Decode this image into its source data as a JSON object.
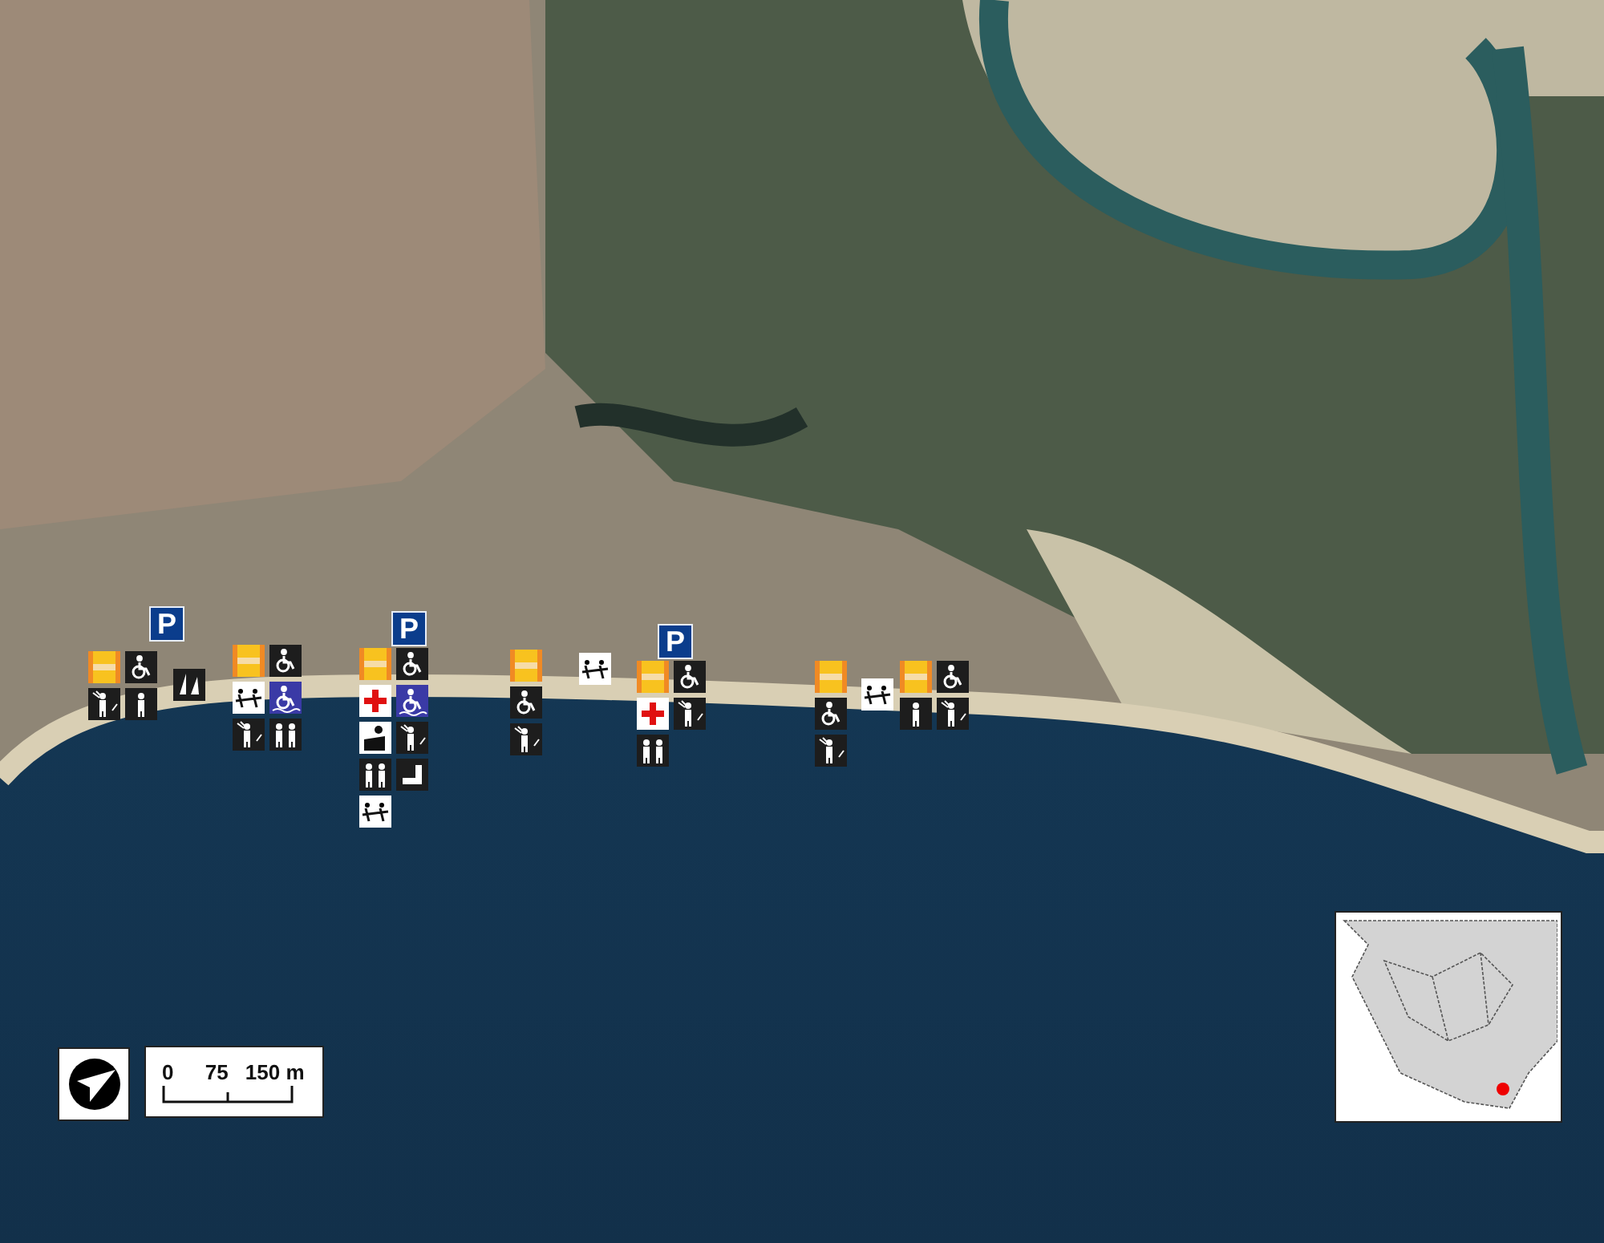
{
  "parking": [
    {
      "label": "P"
    },
    {
      "label": "P"
    },
    {
      "label": "P"
    }
  ],
  "icon_groups": [
    {
      "icons": [
        {
          "kind": "flag"
        },
        {
          "kind": "wheelchair"
        },
        {
          "kind": "shower"
        },
        {
          "kind": "walker"
        }
      ]
    },
    {
      "icons": [
        {
          "kind": "boats"
        }
      ]
    },
    {
      "icons": [
        {
          "kind": "flag"
        },
        {
          "kind": "wheelchair"
        },
        {
          "kind": "games"
        },
        {
          "kind": "wheelchair-water"
        },
        {
          "kind": "shower"
        },
        {
          "kind": "wc"
        }
      ]
    },
    {
      "icons": [
        {
          "kind": "flag"
        },
        {
          "kind": "wheelchair"
        },
        {
          "kind": "first-aid"
        },
        {
          "kind": "wheelchair-water"
        },
        {
          "kind": "lifeguard"
        },
        {
          "kind": "shower"
        },
        {
          "kind": "wc"
        },
        {
          "kind": "ladder"
        },
        {
          "kind": "games"
        }
      ]
    },
    {
      "icons": [
        {
          "kind": "flag"
        },
        {
          "kind": "wheelchair"
        },
        {
          "kind": "shower"
        }
      ]
    },
    {
      "icons": [
        {
          "kind": "games"
        }
      ]
    },
    {
      "icons": [
        {
          "kind": "flag"
        },
        {
          "kind": "wheelchair"
        },
        {
          "kind": "first-aid"
        },
        {
          "kind": "shower"
        },
        {
          "kind": "wc"
        }
      ]
    },
    {
      "icons": [
        {
          "kind": "flag"
        },
        {
          "kind": "wheelchair"
        },
        {
          "kind": "shower"
        }
      ]
    },
    {
      "icons": [
        {
          "kind": "games"
        }
      ]
    },
    {
      "icons": [
        {
          "kind": "flag"
        },
        {
          "kind": "wheelchair"
        },
        {
          "kind": "walker"
        },
        {
          "kind": "shower"
        }
      ]
    }
  ],
  "scale_bar": {
    "labels": [
      "0",
      "75",
      "150 m"
    ]
  }
}
